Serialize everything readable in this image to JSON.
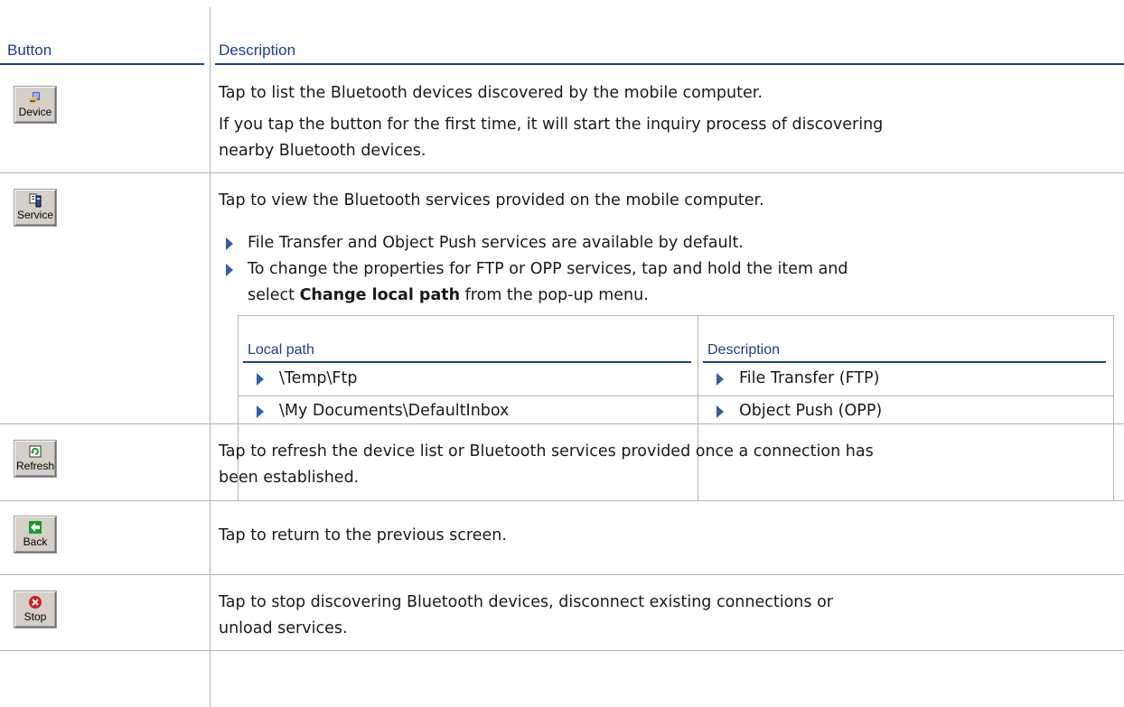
{
  "header": {
    "button_col": "Button",
    "description_col": "Description"
  },
  "rows": [
    {
      "button_label": "Device",
      "icon": "device-icon",
      "lines": [
        "Tap to list the Bluetooth devices discovered by the mobile computer.",
        "If you tap the button for the first time, it will start the inquiry process of discovering",
        "nearby Bluetooth devices."
      ]
    },
    {
      "button_label": "Service",
      "icon": "service-icon",
      "intro": "Tap to view the Bluetooth services provided on the mobile computer.",
      "bullets": [
        {
          "text": "File Transfer and Object Push services are available by default."
        },
        {
          "line1": "To change the properties for FTP or OPP services, tap and hold the item and",
          "pre": "select ",
          "bold": "Change local path",
          "post": " from the pop-up menu."
        }
      ],
      "inner_table": {
        "headers": [
          "Local path",
          "Description"
        ],
        "rows": [
          [
            "\\Temp\\Ftp",
            "File Transfer (FTP)"
          ],
          [
            "\\My Documents\\DefaultInbox",
            "Object Push (OPP)"
          ]
        ]
      }
    },
    {
      "button_label": "Refresh",
      "icon": "refresh-icon",
      "lines": [
        "Tap to refresh the device list or Bluetooth services provided once a connection has",
        "been established."
      ]
    },
    {
      "button_label": "Back",
      "icon": "back-arrow-icon",
      "lines": [
        "Tap to return to the previous screen."
      ]
    },
    {
      "button_label": "Stop",
      "icon": "stop-icon",
      "lines": [
        "Tap to stop discovering Bluetooth devices, disconnect existing connections or",
        "unload services."
      ]
    }
  ],
  "colors": {
    "header_blue": "#1c3d8c",
    "bullet_blue": "#2f5fa8",
    "button_face": "#d4d0c8",
    "rule_gray": "#b3b3b3"
  }
}
